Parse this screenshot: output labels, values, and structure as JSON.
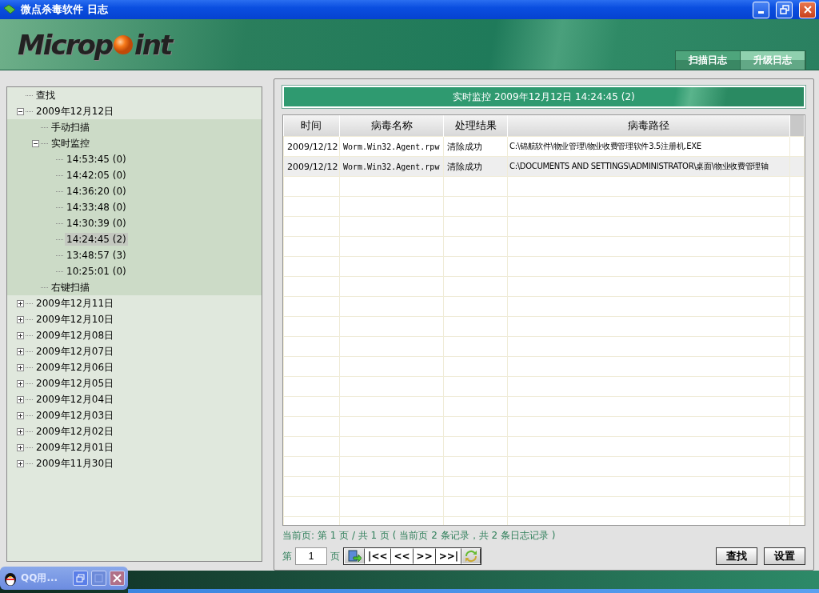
{
  "window": {
    "title": "微点杀毒软件  日志"
  },
  "logo": {
    "text_start": "Microp",
    "text_end": "int"
  },
  "tabs": [
    {
      "label": "扫描日志",
      "selected": false
    },
    {
      "label": "升级日志",
      "selected": true
    }
  ],
  "tree": [
    {
      "label": "查找",
      "selected": false
    },
    {
      "label": "2009年12月12日",
      "selected": false,
      "expanded": true,
      "children": [
        {
          "label": "手动扫描",
          "selected": false
        },
        {
          "label": "实时监控",
          "selected": false,
          "expanded": true,
          "children": [
            {
              "label": "14:53:45 (0)",
              "selected": false
            },
            {
              "label": "14:42:05 (0)",
              "selected": false
            },
            {
              "label": "14:36:20 (0)",
              "selected": false
            },
            {
              "label": "14:33:48 (0)",
              "selected": false
            },
            {
              "label": "14:30:39 (0)",
              "selected": false
            },
            {
              "label": "14:24:45 (2)",
              "selected": true
            },
            {
              "label": "13:48:57 (3)",
              "selected": false
            },
            {
              "label": "10:25:01 (0)",
              "selected": false
            }
          ]
        },
        {
          "label": "右键扫描",
          "selected": false
        }
      ]
    },
    {
      "label": "2009年12月11日",
      "selected": false,
      "expanded": false
    },
    {
      "label": "2009年12月10日",
      "selected": false,
      "expanded": false
    },
    {
      "label": "2009年12月08日",
      "selected": false,
      "expanded": false
    },
    {
      "label": "2009年12月07日",
      "selected": false,
      "expanded": false
    },
    {
      "label": "2009年12月06日",
      "selected": false,
      "expanded": false
    },
    {
      "label": "2009年12月05日",
      "selected": false,
      "expanded": false
    },
    {
      "label": "2009年12月04日",
      "selected": false,
      "expanded": false
    },
    {
      "label": "2009年12月03日",
      "selected": false,
      "expanded": false
    },
    {
      "label": "2009年12月02日",
      "selected": false,
      "expanded": false
    },
    {
      "label": "2009年12月01日",
      "selected": false,
      "expanded": false
    },
    {
      "label": "2009年11月30日",
      "selected": false,
      "expanded": false
    }
  ],
  "panel_title": "实时监控 2009年12月12日 14:24:45 (2)",
  "table": {
    "columns": [
      "时间",
      "病毒名称",
      "处理结果",
      "病毒路径"
    ],
    "rows": [
      [
        "2009/12/12",
        "Worm.Win32.Agent.rpw",
        "清除成功",
        "C:\\锦航软件\\物业管理\\物业收费管理软件3.5注册机.EXE"
      ],
      [
        "2009/12/12",
        "Worm.Win32.Agent.rpw",
        "清除成功",
        "C:\\DOCUMENTS AND SETTINGS\\ADMINISTRATOR\\桌面\\物业收费管理轴"
      ]
    ]
  },
  "page_info": "当前页: 第 1 页 / 共 1 页 ( 当前页 2 条记录，共 2 条日志记录 )",
  "pager": {
    "prefix": "第",
    "value": "1",
    "suffix": "页",
    "buttons": [
      {
        "kind": "export"
      },
      {
        "kind": "text",
        "label": "|<<"
      },
      {
        "kind": "text",
        "label": "<<"
      },
      {
        "kind": "text",
        "label": ">>"
      },
      {
        "kind": "text",
        "label": ">>|"
      },
      {
        "kind": "refresh"
      }
    ]
  },
  "actions": [
    "查找",
    "设置"
  ],
  "taskbar_window": {
    "title": "QQ用..."
  }
}
